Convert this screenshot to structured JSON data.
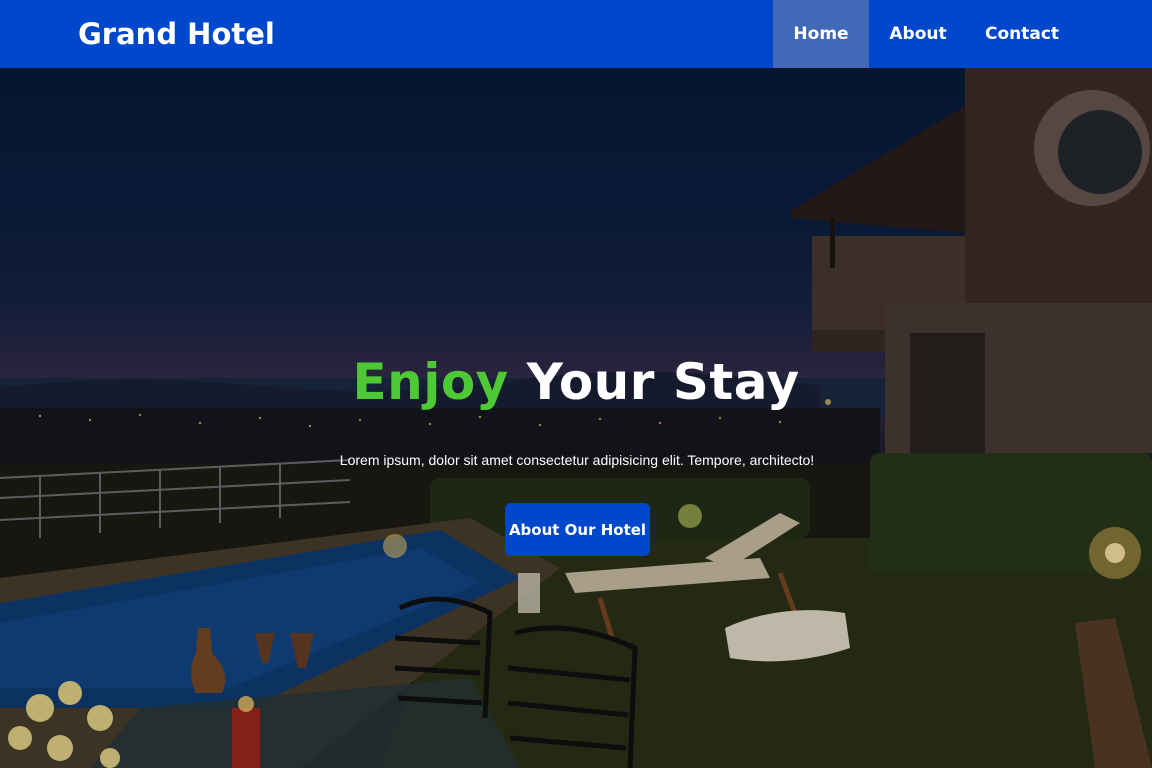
{
  "navbar": {
    "brand": "Grand Hotel",
    "items": [
      {
        "label": "Home",
        "active": true
      },
      {
        "label": "About",
        "active": false
      },
      {
        "label": "Contact",
        "active": false
      }
    ],
    "colors": {
      "background": "#0047cc",
      "active_item": "#4169b8"
    }
  },
  "hero": {
    "title_accent": "Enjoy",
    "title_rest": "Your Stay",
    "subtitle": "Lorem ipsum, dolor sit amet consectetur adipisicing elit. Tempore, architecto!",
    "cta_label": "About Our Hotel",
    "colors": {
      "accent": "#4fc836",
      "cta": "#0047cc"
    }
  }
}
